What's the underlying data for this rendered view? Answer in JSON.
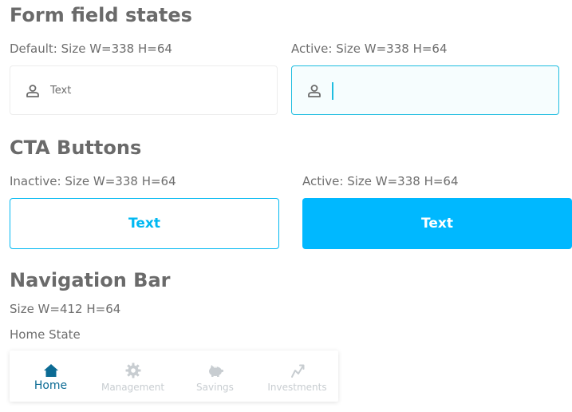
{
  "form_section": {
    "title": "Form field states",
    "default_caption": "Default: Size W=338 H=64",
    "active_caption": "Active: Size W=338 H=64",
    "default_field": {
      "icon": "user-icon",
      "placeholder": "Text"
    },
    "active_field": {
      "icon": "user-icon",
      "value": ""
    }
  },
  "cta_section": {
    "title": "CTA Buttons",
    "inactive_caption": "Inactive: Size W=338 H=64",
    "active_caption": "Active: Size W=338 H=64",
    "inactive_button_label": "Text",
    "active_button_label": "Text"
  },
  "nav_section": {
    "title": "Navigation Bar",
    "size_caption": "Size W=412 H=64",
    "state_caption": "Home State",
    "items": [
      {
        "label": "Home",
        "icon": "home-icon"
      },
      {
        "label": "Management",
        "icon": "gear-icon"
      },
      {
        "label": "Savings",
        "icon": "piggy-bank-icon"
      },
      {
        "label": "Investments",
        "icon": "trend-up-icon"
      }
    ]
  },
  "colors": {
    "accent": "#00b8ff",
    "accent_border": "#1fbde0",
    "nav_active": "#0c6b94",
    "nav_muted": "#c8cdd1",
    "title_gray": "#6a6a6a"
  }
}
